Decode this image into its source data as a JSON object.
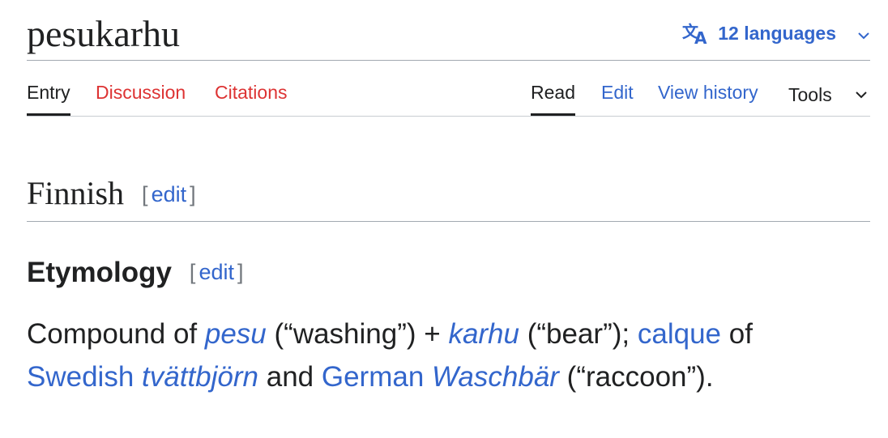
{
  "title": "pesukarhu",
  "languages": {
    "icon": "translate-icon",
    "label": "12 languages",
    "chevron": "⌄"
  },
  "tabs_left": [
    "Entry",
    "Discussion",
    "Citations"
  ],
  "tabs_right": [
    "Read",
    "Edit",
    "View history",
    "Tools"
  ],
  "sections": {
    "finnish": {
      "heading": "Finnish",
      "edit": "edit",
      "bracket_open": "[",
      "bracket_close": "]"
    },
    "etymology": {
      "heading": "Etymology",
      "edit": "edit",
      "bracket_open": "[",
      "bracket_close": "]"
    }
  },
  "paragraph": {
    "t1": "Compound of ",
    "l1": "pesu",
    "t2": " (“washing”) + ",
    "l2": "karhu",
    "t3": " (“bear”); ",
    "l3": "calque",
    "t4": " of",
    "l4": "Swedish",
    "t5": " ",
    "l5": "tvättbjörn",
    "t6": " and ",
    "l6": "German",
    "t7": " ",
    "l7": "Waschbär",
    "t8": " (“raccoon”)."
  },
  "colors": {
    "link": "#3366cc",
    "redlink": "#d33333",
    "text": "#202122",
    "rule": "#a2a9b1"
  }
}
